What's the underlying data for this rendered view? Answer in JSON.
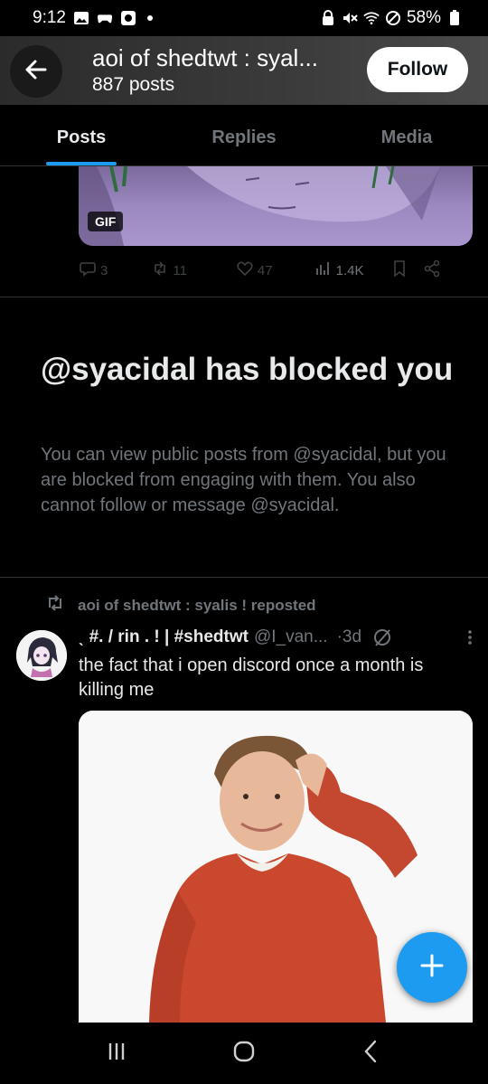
{
  "status_bar": {
    "time": "9:12",
    "battery": "58%"
  },
  "header": {
    "title": "aoi of shedtwt : syal...",
    "subtitle": "887 posts",
    "follow_label": "Follow"
  },
  "tabs": [
    {
      "label": "Posts",
      "active": true
    },
    {
      "label": "Replies",
      "active": false
    },
    {
      "label": "Media",
      "active": false
    }
  ],
  "gif_post": {
    "badge": "GIF",
    "replies": "3",
    "reposts": "11",
    "likes": "47",
    "views": "1.4K"
  },
  "blocked_notice": {
    "title": "@syacidal has blocked you",
    "body": "You can view public posts from @syacidal, but you are blocked from engaging with them. You also cannot follow or message @syacidal."
  },
  "repost": {
    "label": "aoi of shedtwt : syalis ! reposted",
    "author_name": "ˎ #. / rin . ! | #shedtwt",
    "handle": "@I_van...",
    "time": "·3d",
    "text": "the fact that i open discord once a month is killing me"
  },
  "colors": {
    "accent": "#1d9bf0",
    "background": "#000000",
    "muted_text": "#71767b"
  }
}
